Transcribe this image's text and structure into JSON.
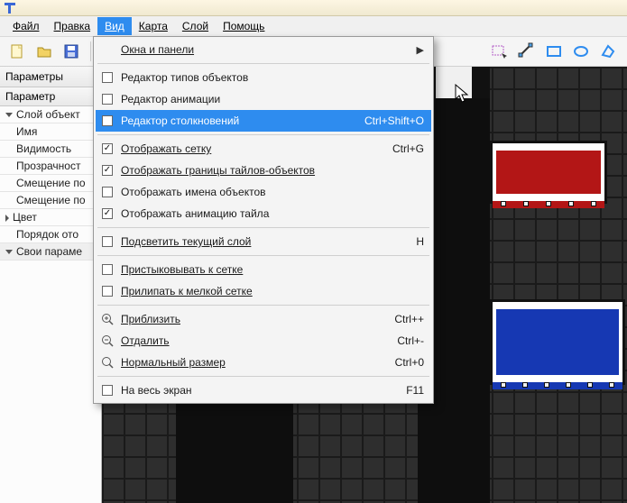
{
  "menubar": {
    "file": "Файл",
    "edit": "Правка",
    "view": "Вид",
    "map": "Карта",
    "layer": "Слой",
    "help": "Помощь"
  },
  "panel": {
    "title": "Параметры",
    "header": "Параметр",
    "section_layer": "Слой объект",
    "name": "Имя",
    "visibility": "Видимость",
    "opacity": "Прозрачност",
    "offset1": "Смещение по",
    "offset2": "Смещение по",
    "color": "Цвет",
    "order": "Порядок ото",
    "section_custom": "Свои параме"
  },
  "dropdown": {
    "windows_panels": "Окна и панели",
    "type_editor": "Редактор типов объектов",
    "anim_editor": "Редактор анимации",
    "collision_editor": "Редактор столкновений",
    "collision_shortcut": "Ctrl+Shift+O",
    "show_grid": "Отображать сетку",
    "show_grid_shortcut": "Ctrl+G",
    "show_tile_bounds": "Отображать границы тайлов-объектов",
    "show_obj_names": "Отображать имена объектов",
    "show_tile_anim": "Отображать анимацию тайла",
    "highlight_layer": "Подсветить текущий слой",
    "highlight_shortcut": "H",
    "snap_grid": "Пристыковывать к сетке",
    "snap_fine": "Прилипать к мелкой сетке",
    "zoom_in": "Приблизить",
    "zoom_in_shortcut": "Ctrl++",
    "zoom_out": "Отдалить",
    "zoom_out_shortcut": "Ctrl+-",
    "normal_size": "Нормальный размер",
    "normal_size_shortcut": "Ctrl+0",
    "fullscreen": "На весь экран",
    "fullscreen_shortcut": "F11"
  }
}
